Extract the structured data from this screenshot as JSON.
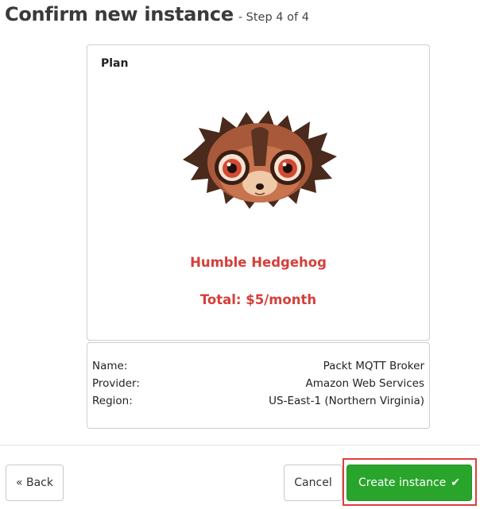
{
  "header": {
    "title": "Confirm new instance",
    "step": "- Step 4 of 4"
  },
  "plan": {
    "label": "Plan",
    "name": "Humble Hedgehog",
    "total": "Total: $5/month",
    "accent_color": "#d43f3a",
    "mascot_icon": "hedgehog-mascot"
  },
  "details": {
    "rows": [
      {
        "label": "Name:",
        "value": "Packt MQTT Broker"
      },
      {
        "label": "Provider:",
        "value": "Amazon Web Services"
      },
      {
        "label": "Region:",
        "value": "US-East-1 (Northern Virginia)"
      }
    ]
  },
  "actions": {
    "back_label": "« Back",
    "cancel_label": "Cancel",
    "create_label": "Create instance",
    "create_icon": "checkmark-icon",
    "create_color": "#2aa52c",
    "highlight_color": "#d9413a"
  }
}
